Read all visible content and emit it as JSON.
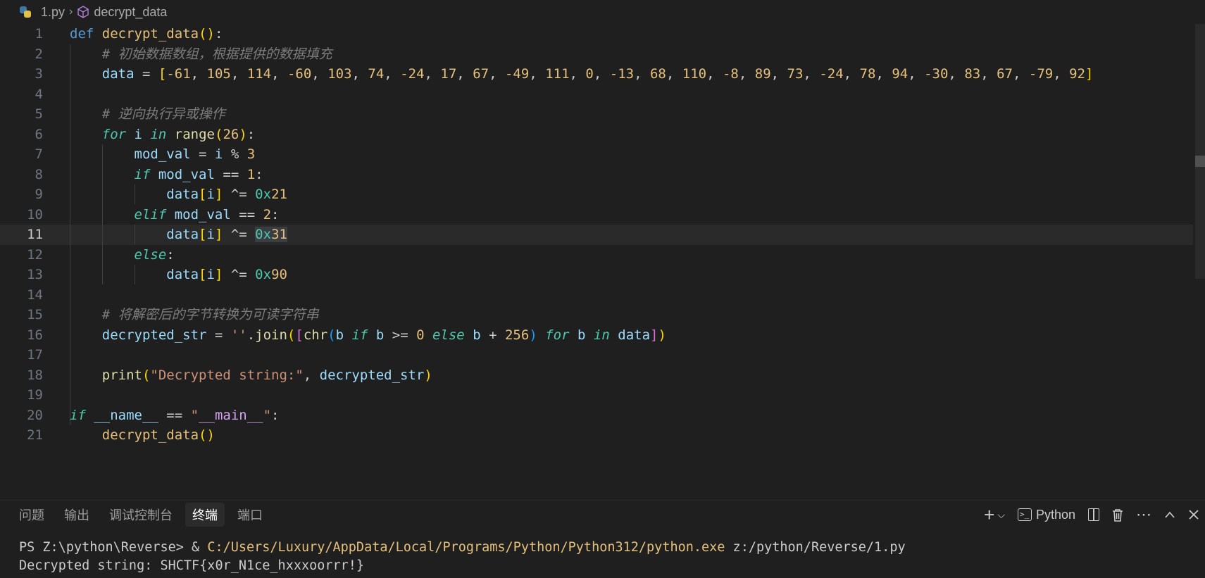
{
  "breadcrumb": {
    "file": "1.py",
    "symbol": "decrypt_data",
    "file_icon": "python-file-icon",
    "symbol_icon": "cube-icon"
  },
  "editor": {
    "language": "python",
    "current_line": 11,
    "lines": [
      "def decrypt_data():",
      "    # 初始数据数组，根据提供的数据填充",
      "    data = [-61, 105, 114, -60, 103, 74, -24, 17, 67, -49, 111, 0, -13, 68, 110, -8, 89, 73, -24, 78, 94, -30, 83, 67, -79, 92]",
      "",
      "    # 逆向执行异或操作",
      "    for i in range(26):",
      "        mod_val = i % 3",
      "        if mod_val == 1:",
      "            data[i] ^= 0x21",
      "        elif mod_val == 2:",
      "            data[i] ^= 0x31",
      "        else:",
      "            data[i] ^= 0x90",
      "",
      "    # 将解密后的字节转换为可读字符串",
      "    decrypted_str = ''.join([chr(b if b >= 0 else b + 256) for b in data])",
      "",
      "    print(\"Decrypted string:\", decrypted_str)",
      "",
      "if __name__ == \"__main__\":",
      "    decrypt_data()"
    ],
    "line_numbers": [
      "1",
      "2",
      "3",
      "4",
      "5",
      "6",
      "7",
      "8",
      "9",
      "10",
      "11",
      "12",
      "13",
      "14",
      "15",
      "16",
      "17",
      "18",
      "19",
      "20",
      "21"
    ]
  },
  "panel": {
    "tabs": [
      {
        "label": "问题",
        "active": false
      },
      {
        "label": "输出",
        "active": false
      },
      {
        "label": "调试控制台",
        "active": false
      },
      {
        "label": "终端",
        "active": true
      },
      {
        "label": "端口",
        "active": false
      }
    ],
    "terminal_profile": "Python",
    "actions": [
      "add-terminal-icon",
      "chevron-down-icon",
      "terminal-icon",
      "split-icon",
      "trash-icon",
      "more-icon",
      "maximize-icon",
      "close-icon"
    ]
  },
  "terminal": {
    "prompt": "PS Z:\\python\\Reverse> & ",
    "exe_path": "C:/Users/Luxury/AppData/Local/Programs/Python/Python312/python.exe",
    "script_arg": " z:/python/Reverse/1.py",
    "output": "Decrypted string: SHCTF{x0r_N1ce_hxxxoorrr!}"
  },
  "colors": {
    "background": "#1f1f1f",
    "current_line": "#2a2a2a",
    "keyword": "#569cd6",
    "function": "#dcdcaa",
    "variable": "#9cdcfe",
    "comment": "#6a9955"
  }
}
